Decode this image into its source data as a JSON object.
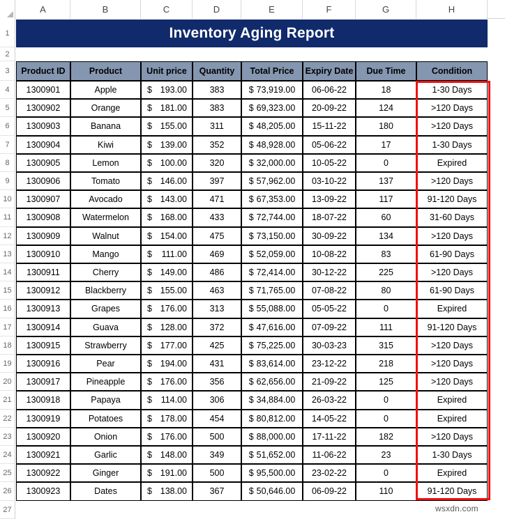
{
  "app": {
    "type": "spreadsheet",
    "watermark": "wsxdn.com"
  },
  "grid": {
    "column_letters": [
      "A",
      "B",
      "C",
      "D",
      "E",
      "F",
      "G",
      "H"
    ],
    "row_numbers": [
      "1",
      "2",
      "3",
      "4",
      "5",
      "6",
      "7",
      "8",
      "9",
      "10",
      "11",
      "12",
      "13",
      "14",
      "15",
      "16",
      "17",
      "18",
      "19",
      "20",
      "21",
      "22",
      "23",
      "24",
      "25",
      "26",
      "27"
    ]
  },
  "title": {
    "text": "Inventory Aging Report",
    "fill": "#102a6b",
    "color": "#ffffff"
  },
  "table": {
    "header_fill": "#8496b0",
    "headers": [
      "Product ID",
      "Product",
      "Unit price",
      "Quantity",
      "Total Price",
      "Expiry Date",
      "Due Time",
      "Condition"
    ],
    "rows": [
      {
        "product_id": "1300901",
        "product": "Apple",
        "unit_price_sym": "$",
        "unit_price": "193.00",
        "quantity": "383",
        "total_sym": "$",
        "total_price": "73,919.00",
        "expiry_date": "06-06-22",
        "due_time": "18",
        "condition": "1-30 Days"
      },
      {
        "product_id": "1300902",
        "product": "Orange",
        "unit_price_sym": "$",
        "unit_price": "181.00",
        "quantity": "383",
        "total_sym": "$",
        "total_price": "69,323.00",
        "expiry_date": "20-09-22",
        "due_time": "124",
        "condition": ">120 Days"
      },
      {
        "product_id": "1300903",
        "product": "Banana",
        "unit_price_sym": "$",
        "unit_price": "155.00",
        "quantity": "311",
        "total_sym": "$",
        "total_price": "48,205.00",
        "expiry_date": "15-11-22",
        "due_time": "180",
        "condition": ">120 Days"
      },
      {
        "product_id": "1300904",
        "product": "Kiwi",
        "unit_price_sym": "$",
        "unit_price": "139.00",
        "quantity": "352",
        "total_sym": "$",
        "total_price": "48,928.00",
        "expiry_date": "05-06-22",
        "due_time": "17",
        "condition": "1-30 Days"
      },
      {
        "product_id": "1300905",
        "product": "Lemon",
        "unit_price_sym": "$",
        "unit_price": "100.00",
        "quantity": "320",
        "total_sym": "$",
        "total_price": "32,000.00",
        "expiry_date": "10-05-22",
        "due_time": "0",
        "condition": "Expired"
      },
      {
        "product_id": "1300906",
        "product": "Tomato",
        "unit_price_sym": "$",
        "unit_price": "146.00",
        "quantity": "397",
        "total_sym": "$",
        "total_price": "57,962.00",
        "expiry_date": "03-10-22",
        "due_time": "137",
        "condition": ">120 Days"
      },
      {
        "product_id": "1300907",
        "product": "Avocado",
        "unit_price_sym": "$",
        "unit_price": "143.00",
        "quantity": "471",
        "total_sym": "$",
        "total_price": "67,353.00",
        "expiry_date": "13-09-22",
        "due_time": "117",
        "condition": "91-120 Days"
      },
      {
        "product_id": "1300908",
        "product": "Watermelon",
        "unit_price_sym": "$",
        "unit_price": "168.00",
        "quantity": "433",
        "total_sym": "$",
        "total_price": "72,744.00",
        "expiry_date": "18-07-22",
        "due_time": "60",
        "condition": "31-60 Days"
      },
      {
        "product_id": "1300909",
        "product": "Walnut",
        "unit_price_sym": "$",
        "unit_price": "154.00",
        "quantity": "475",
        "total_sym": "$",
        "total_price": "73,150.00",
        "expiry_date": "30-09-22",
        "due_time": "134",
        "condition": ">120 Days"
      },
      {
        "product_id": "1300910",
        "product": "Mango",
        "unit_price_sym": "$",
        "unit_price": "111.00",
        "quantity": "469",
        "total_sym": "$",
        "total_price": "52,059.00",
        "expiry_date": "10-08-22",
        "due_time": "83",
        "condition": "61-90 Days"
      },
      {
        "product_id": "1300911",
        "product": "Cherry",
        "unit_price_sym": "$",
        "unit_price": "149.00",
        "quantity": "486",
        "total_sym": "$",
        "total_price": "72,414.00",
        "expiry_date": "30-12-22",
        "due_time": "225",
        "condition": ">120 Days"
      },
      {
        "product_id": "1300912",
        "product": "Blackberry",
        "unit_price_sym": "$",
        "unit_price": "155.00",
        "quantity": "463",
        "total_sym": "$",
        "total_price": "71,765.00",
        "expiry_date": "07-08-22",
        "due_time": "80",
        "condition": "61-90 Days"
      },
      {
        "product_id": "1300913",
        "product": "Grapes",
        "unit_price_sym": "$",
        "unit_price": "176.00",
        "quantity": "313",
        "total_sym": "$",
        "total_price": "55,088.00",
        "expiry_date": "05-05-22",
        "due_time": "0",
        "condition": "Expired"
      },
      {
        "product_id": "1300914",
        "product": "Guava",
        "unit_price_sym": "$",
        "unit_price": "128.00",
        "quantity": "372",
        "total_sym": "$",
        "total_price": "47,616.00",
        "expiry_date": "07-09-22",
        "due_time": "111",
        "condition": "91-120 Days"
      },
      {
        "product_id": "1300915",
        "product": "Strawberry",
        "unit_price_sym": "$",
        "unit_price": "177.00",
        "quantity": "425",
        "total_sym": "$",
        "total_price": "75,225.00",
        "expiry_date": "30-03-23",
        "due_time": "315",
        "condition": ">120 Days"
      },
      {
        "product_id": "1300916",
        "product": "Pear",
        "unit_price_sym": "$",
        "unit_price": "194.00",
        "quantity": "431",
        "total_sym": "$",
        "total_price": "83,614.00",
        "expiry_date": "23-12-22",
        "due_time": "218",
        "condition": ">120 Days"
      },
      {
        "product_id": "1300917",
        "product": "Pineapple",
        "unit_price_sym": "$",
        "unit_price": "176.00",
        "quantity": "356",
        "total_sym": "$",
        "total_price": "62,656.00",
        "expiry_date": "21-09-22",
        "due_time": "125",
        "condition": ">120 Days"
      },
      {
        "product_id": "1300918",
        "product": "Papaya",
        "unit_price_sym": "$",
        "unit_price": "114.00",
        "quantity": "306",
        "total_sym": "$",
        "total_price": "34,884.00",
        "expiry_date": "26-03-22",
        "due_time": "0",
        "condition": "Expired"
      },
      {
        "product_id": "1300919",
        "product": "Potatoes",
        "unit_price_sym": "$",
        "unit_price": "178.00",
        "quantity": "454",
        "total_sym": "$",
        "total_price": "80,812.00",
        "expiry_date": "14-05-22",
        "due_time": "0",
        "condition": "Expired"
      },
      {
        "product_id": "1300920",
        "product": "Onion",
        "unit_price_sym": "$",
        "unit_price": "176.00",
        "quantity": "500",
        "total_sym": "$",
        "total_price": "88,000.00",
        "expiry_date": "17-11-22",
        "due_time": "182",
        "condition": ">120 Days"
      },
      {
        "product_id": "1300921",
        "product": "Garlic",
        "unit_price_sym": "$",
        "unit_price": "148.00",
        "quantity": "349",
        "total_sym": "$",
        "total_price": "51,652.00",
        "expiry_date": "11-06-22",
        "due_time": "23",
        "condition": "1-30 Days"
      },
      {
        "product_id": "1300922",
        "product": "Ginger",
        "unit_price_sym": "$",
        "unit_price": "191.00",
        "quantity": "500",
        "total_sym": "$",
        "total_price": "95,500.00",
        "expiry_date": "23-02-22",
        "due_time": "0",
        "condition": "Expired"
      },
      {
        "product_id": "1300923",
        "product": "Dates",
        "unit_price_sym": "$",
        "unit_price": "138.00",
        "quantity": "367",
        "total_sym": "$",
        "total_price": "50,646.00",
        "expiry_date": "06-09-22",
        "due_time": "110",
        "condition": "91-120 Days"
      }
    ]
  },
  "highlight": {
    "color": "#ee1111",
    "target_column": "H"
  }
}
